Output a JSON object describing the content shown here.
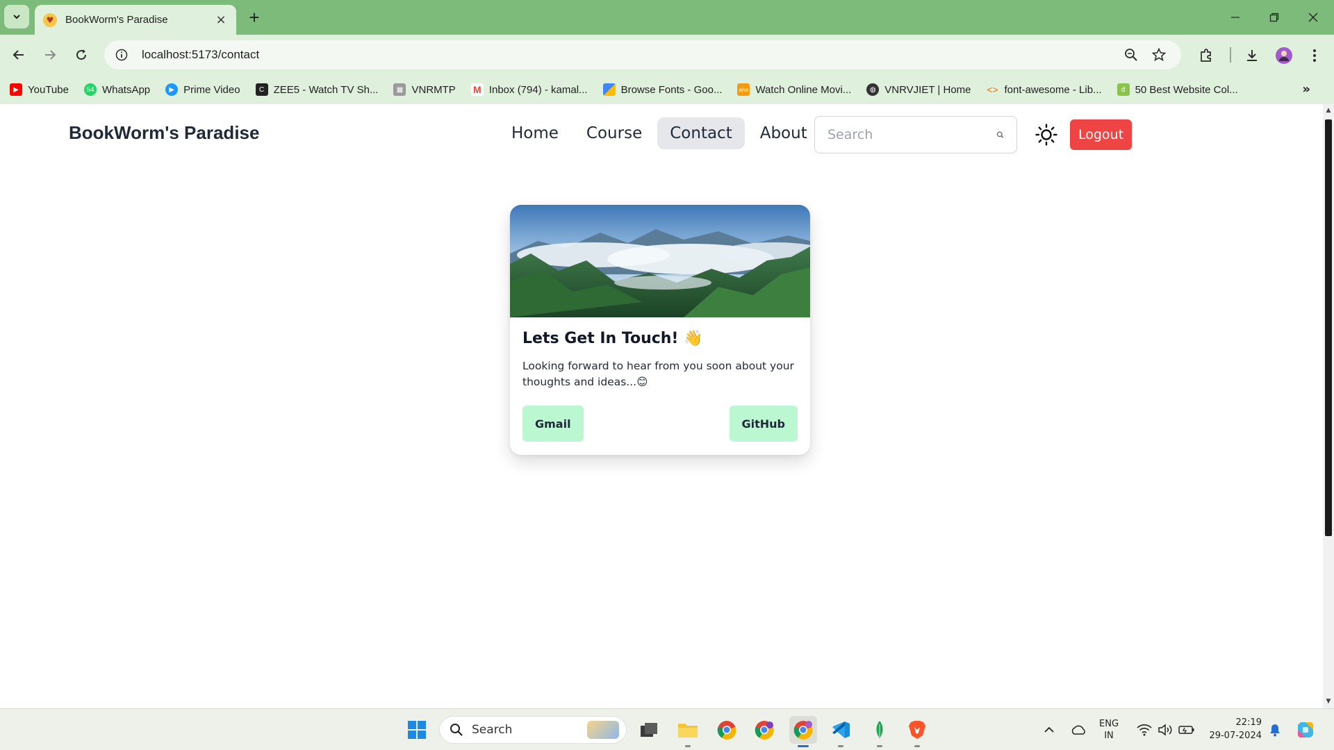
{
  "browser": {
    "tab_title": "BookWorm's Paradise",
    "url": "localhost:5173/contact",
    "bookmarks": [
      {
        "label": "YouTube",
        "color": "#ff0000"
      },
      {
        "label": "WhatsApp",
        "color": "#25d366"
      },
      {
        "label": "Prime Video",
        "color": "#1a98ff"
      },
      {
        "label": "ZEE5 - Watch TV Sh...",
        "color": "#222222"
      },
      {
        "label": "VNRMTP",
        "color": "#8a8a8a"
      },
      {
        "label": "Inbox (794) - kamal...",
        "color": "#ea4335"
      },
      {
        "label": "Browse Fonts - Goo...",
        "color": "#4285f4"
      },
      {
        "label": "Watch Online Movi...",
        "color": "#f39c12"
      },
      {
        "label": "VNRVJIET | Home",
        "color": "#333333"
      },
      {
        "label": "font-awesome - Lib...",
        "color": "#e8710a"
      },
      {
        "label": "50 Best Website Col...",
        "color": "#8bc34a"
      }
    ]
  },
  "site": {
    "brand": "BookWorm's Paradise",
    "nav": [
      "Home",
      "Course",
      "Contact",
      "About"
    ],
    "active_nav": "Contact",
    "search_placeholder": "Search",
    "logout_label": "Logout"
  },
  "card": {
    "title": "Lets Get In Touch! 👋",
    "text": "Looking forward to hear from you soon about your thoughts and ideas...😊",
    "buttons": [
      "Gmail",
      "GitHub"
    ]
  },
  "taskbar": {
    "search_label": "Search",
    "language": "ENG",
    "region": "IN",
    "time": "22:19",
    "date": "29-07-2024"
  },
  "colors": {
    "chrome_green": "#7dbb7a",
    "logout_red": "#ef4444",
    "mint_button": "#bbf7d0"
  }
}
